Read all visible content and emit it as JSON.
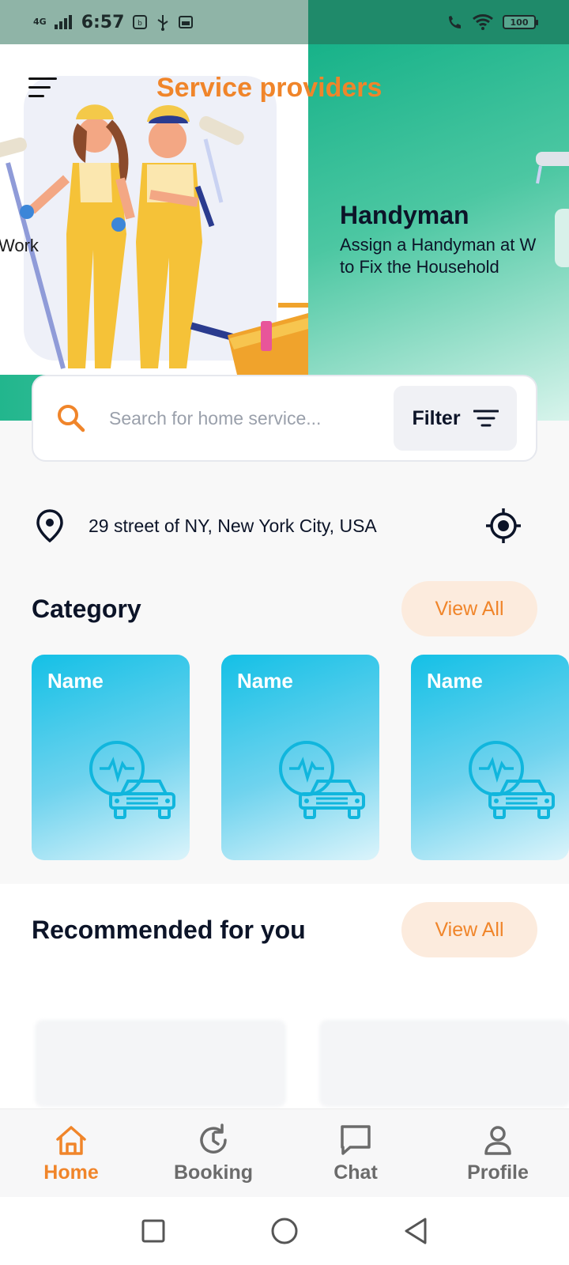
{
  "status_bar": {
    "network": "4G",
    "time": "6:57",
    "battery": "100"
  },
  "banner": {
    "title": "Service providers",
    "prev_slide_fragment": "Work",
    "slide": {
      "title": "Handyman",
      "subtitle_line1": "Assign a Handyman at W",
      "subtitle_line2": "to Fix the Household"
    }
  },
  "search": {
    "placeholder": "Search for home service...",
    "filter_label": "Filter"
  },
  "location": {
    "address": "29 street of NY, New York City, USA"
  },
  "category": {
    "title": "Category",
    "view_all": "View All",
    "items": [
      {
        "name": "Name",
        "icon": "car-diagnostic-icon"
      },
      {
        "name": "Name",
        "icon": "car-diagnostic-icon"
      },
      {
        "name": "Name",
        "icon": "car-diagnostic-icon"
      }
    ]
  },
  "recommended": {
    "title": "Recommended for you",
    "view_all": "View All"
  },
  "bottom_nav": {
    "items": [
      {
        "label": "Home",
        "icon": "home-icon",
        "active": true
      },
      {
        "label": "Booking",
        "icon": "history-icon",
        "active": false
      },
      {
        "label": "Chat",
        "icon": "chat-icon",
        "active": false
      },
      {
        "label": "Profile",
        "icon": "profile-icon",
        "active": false
      }
    ]
  },
  "colors": {
    "accent": "#f0852a",
    "dark_text": "#0c1428",
    "category_card": "#14c0e6",
    "banner_green": "#17b289"
  }
}
